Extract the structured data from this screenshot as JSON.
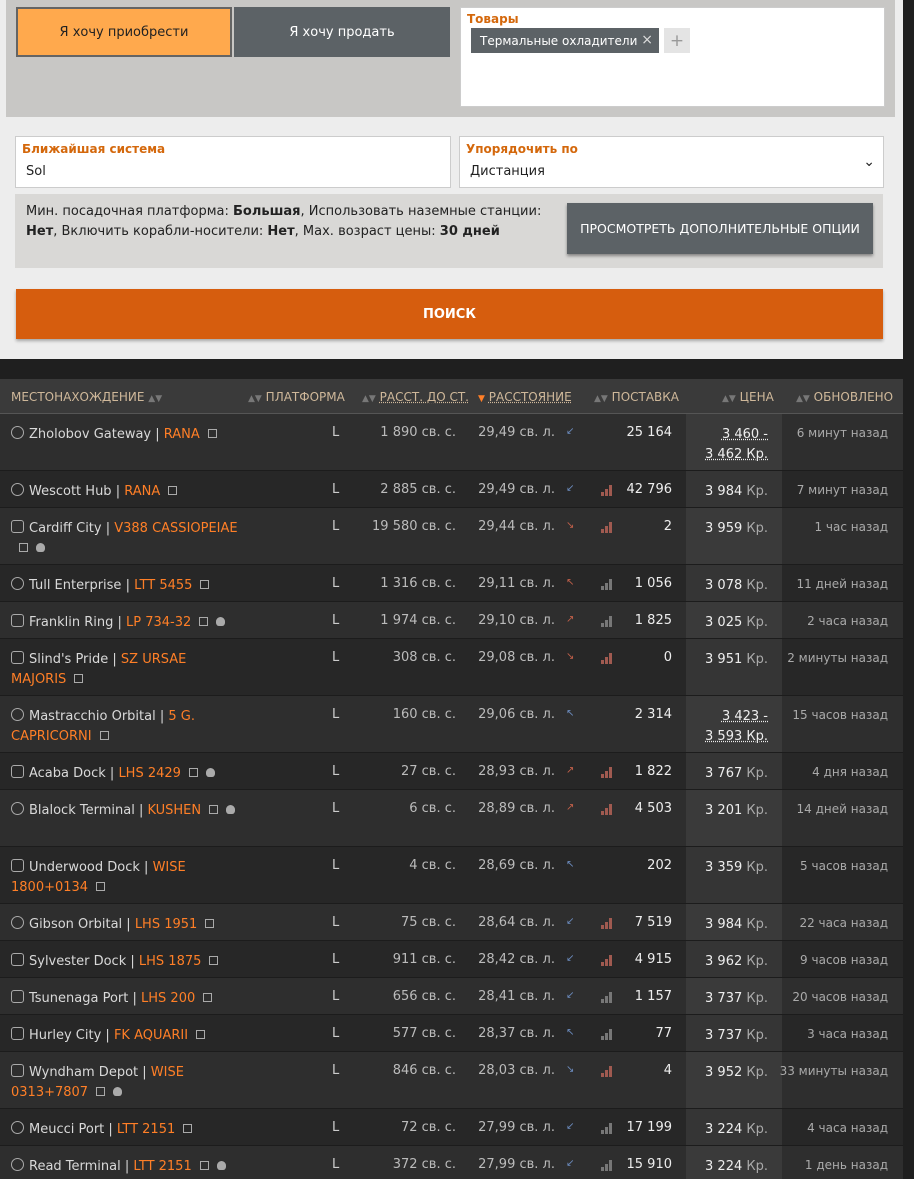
{
  "tabs": {
    "buy": "Я хочу приобрести",
    "sell": "Я хочу продать"
  },
  "goods": {
    "label": "Товары",
    "chip": "Термальные охладители",
    "chip_remove": "×",
    "add": "+"
  },
  "system_field": {
    "label": "Ближайшая система",
    "value": "Sol"
  },
  "sort_field": {
    "label": "Упорядочить по",
    "value": "Дистанция"
  },
  "options": {
    "k1": "Мин. посадочная платформа:",
    "v1": "Большая",
    "k2": "Использовать наземные станции:",
    "v2": "Нет",
    "k3": "Включить корабли-носители:",
    "v3": "Нет",
    "k4": "Мах. возраст цены:",
    "v4": "30 дней",
    "button": "ПРОСМОТРЕТЬ ДОПОЛНИТЕЛЬНЫЕ ОПЦИИ"
  },
  "search_button": "ПОИСК",
  "columns": {
    "location": "МЕСТОНАХОЖДЕНИЕ",
    "pad": "ПЛАТФОРМА",
    "station_dist": "РАССТ. ДО СТ.",
    "distance": "РАССТОЯНИЕ",
    "supply": "ПОСТАВКА",
    "price": "ЦЕНА",
    "updated": "ОБНОВЛЕНО"
  },
  "rows": [
    {
      "station": "Zholobov Gateway",
      "system": "RANA",
      "pad": "L",
      "st_dist": "1 890 св. с.",
      "dist": "29,49 св. л.",
      "supply": "25 164",
      "price": "3 460 -",
      "price2": "3 462 Кр.",
      "updated": "6 минут назад",
      "icon": "circle",
      "skull": false,
      "wrap": false,
      "sysline2": false
    },
    {
      "station": "Wescott Hub",
      "system": "RANA",
      "pad": "L",
      "st_dist": "2 885 св. с.",
      "dist": "29,49 св. л.",
      "supply": "42 796",
      "price": "3 984",
      "updated": "7 минут назад",
      "icon": "circle",
      "skull": false
    },
    {
      "station": "Cardiff City",
      "system": "V388 CASSIOPEIAE",
      "pad": "L",
      "st_dist": "19 580 св. с.",
      "dist": "29,44 св. л.",
      "supply": "2",
      "price": "3 959",
      "updated": "1 час назад",
      "icon": "square",
      "skull": true
    },
    {
      "station": "Tull Enterprise",
      "system": "LTT 5455",
      "pad": "L",
      "st_dist": "1 316 св. с.",
      "dist": "29,11 св. л.",
      "supply": "1 056",
      "price": "3 078",
      "updated": "11 дней назад",
      "icon": "circle",
      "skull": false
    },
    {
      "station": "Franklin Ring",
      "system": "LP 734-32",
      "pad": "L",
      "st_dist": "1 974 св. с.",
      "dist": "29,10 св. л.",
      "supply": "1 825",
      "price": "3 025",
      "updated": "2 часа назад",
      "icon": "square",
      "skull": true
    },
    {
      "station": "Slind's Pride",
      "system": "SZ URSAE MAJORIS",
      "pad": "L",
      "st_dist": "308 св. с.",
      "dist": "29,08 св. л.",
      "supply": "0",
      "price": "3 951",
      "updated": "2 минуты назад",
      "icon": "square",
      "skull": false
    },
    {
      "station": "Mastracchio Orbital",
      "system": "5 G. CAPRICORNI",
      "pad": "L",
      "st_dist": "160 св. с.",
      "dist": "29,06 св. л.",
      "supply": "2 314",
      "price": "3 423 -",
      "price2": "3 593 Кр.",
      "updated": "15 часов назад",
      "icon": "circle",
      "skull": false
    },
    {
      "station": "Acaba Dock",
      "system": "LHS 2429",
      "pad": "L",
      "st_dist": "27 св. с.",
      "dist": "28,93 св. л.",
      "supply": "1 822",
      "price": "3 767",
      "updated": "4 дня назад",
      "icon": "square",
      "skull": true
    },
    {
      "station": "Blalock Terminal",
      "system": "KUSHEN",
      "pad": "L",
      "st_dist": "6 св. с.",
      "dist": "28,89 св. л.",
      "supply": "4 503",
      "price": "3 201",
      "updated": "14 дней назад",
      "icon": "circle",
      "skull": true
    },
    {
      "station": "Underwood Dock",
      "system": "WISE 1800+0134",
      "pad": "L",
      "st_dist": "4 св. с.",
      "dist": "28,69 св. л.",
      "supply": "202",
      "price": "3 359",
      "updated": "5 часов назад",
      "icon": "square",
      "skull": false
    },
    {
      "station": "Gibson Orbital",
      "system": "LHS 1951",
      "pad": "L",
      "st_dist": "75 св. с.",
      "dist": "28,64 св. л.",
      "supply": "7 519",
      "price": "3 984",
      "updated": "22 часа назад",
      "icon": "circle",
      "skull": false
    },
    {
      "station": "Sylvester Dock",
      "system": "LHS 1875",
      "pad": "L",
      "st_dist": "911 св. с.",
      "dist": "28,42 св. л.",
      "supply": "4 915",
      "price": "3 962",
      "updated": "9 часов назад",
      "icon": "square",
      "skull": false
    },
    {
      "station": "Tsunenaga Port",
      "system": "LHS 200",
      "pad": "L",
      "st_dist": "656 св. с.",
      "dist": "28,41 св. л.",
      "supply": "1 157",
      "price": "3 737",
      "updated": "20 часов назад",
      "icon": "square",
      "skull": false
    },
    {
      "station": "Hurley City",
      "system": "FK AQUARII",
      "pad": "L",
      "st_dist": "577 св. с.",
      "dist": "28,37 св. л.",
      "supply": "77",
      "price": "3 737",
      "updated": "3 часа назад",
      "icon": "square",
      "skull": false
    },
    {
      "station": "Wyndham Depot",
      "system": "WISE 0313+7807",
      "pad": "L",
      "st_dist": "846 св. с.",
      "dist": "28,03 св. л.",
      "supply": "4",
      "price": "3 952",
      "updated": "33 минуты назад",
      "icon": "square",
      "skull": true
    },
    {
      "station": "Meucci Port",
      "system": "LTT 2151",
      "pad": "L",
      "st_dist": "72 св. с.",
      "dist": "27,99 св. л.",
      "supply": "17 199",
      "price": "3 224",
      "updated": "4 часа назад",
      "icon": "circle",
      "skull": false
    },
    {
      "station": "Read Terminal",
      "system": "LTT 2151",
      "pad": "L",
      "st_dist": "372 св. с.",
      "dist": "27,99 св. л.",
      "supply": "15 910",
      "price": "3 224",
      "updated": "1 день назад",
      "icon": "circle",
      "skull": true
    }
  ],
  "currency": "Кр."
}
